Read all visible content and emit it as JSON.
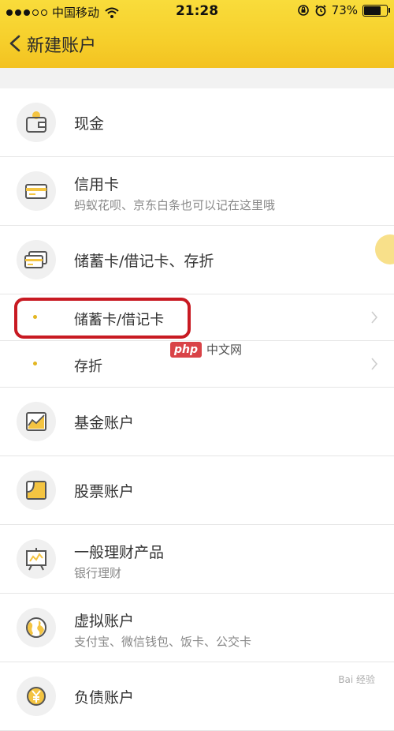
{
  "status_bar": {
    "carrier": "中国移动",
    "time": "21:28",
    "battery": "73%"
  },
  "nav": {
    "title": "新建账户"
  },
  "accounts": [
    {
      "icon": "wallet-icon",
      "title": "现金",
      "subtitle": ""
    },
    {
      "icon": "credit-card-icon",
      "title": "信用卡",
      "subtitle": "蚂蚁花呗、京东白条也可以记在这里哦"
    },
    {
      "icon": "debit-cards-icon",
      "title": "储蓄卡/借记卡、存折",
      "subtitle": ""
    }
  ],
  "debit_options": [
    {
      "title": "储蓄卡/借记卡"
    },
    {
      "title": "存折"
    }
  ],
  "more_accounts": [
    {
      "icon": "fund-chart-icon",
      "title": "基金账户",
      "subtitle": ""
    },
    {
      "icon": "stock-chart-icon",
      "title": "股票账户",
      "subtitle": ""
    },
    {
      "icon": "presentation-board-icon",
      "title": "一般理财产品",
      "subtitle": "银行理财"
    },
    {
      "icon": "globe-icon",
      "title": "虚拟账户",
      "subtitle": "支付宝、微信钱包、饭卡、公交卡"
    },
    {
      "icon": "yen-coin-icon",
      "title": "负债账户",
      "subtitle": ""
    }
  ],
  "watermarks": {
    "php_badge": "php",
    "php_site": "中文网",
    "baidu": "Bai 经验"
  },
  "colors": {
    "accent": "#f6cf2b",
    "highlight_box": "#c81a22"
  }
}
